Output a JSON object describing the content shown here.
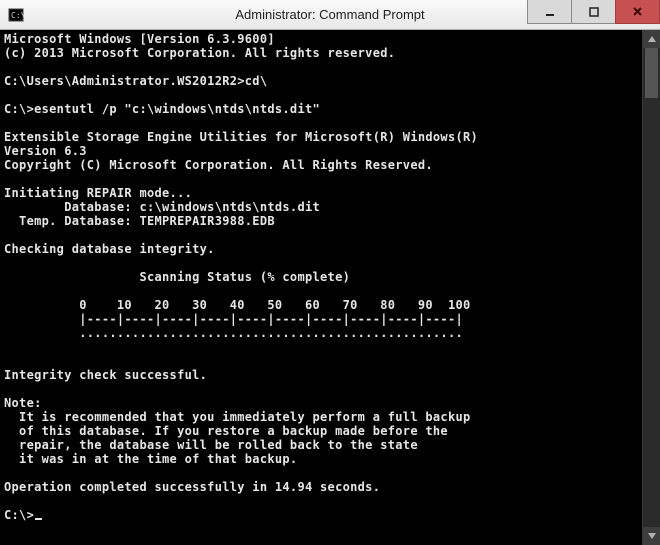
{
  "window": {
    "title": "Administrator: Command Prompt"
  },
  "console": {
    "banner1": "Microsoft Windows [Version 6.3.9600]",
    "banner2": "(c) 2013 Microsoft Corporation. All rights reserved.",
    "prompt1": "C:\\Users\\Administrator.WS2012R2>cd\\",
    "prompt2": "C:\\>esentutl /p \"c:\\windows\\ntds\\ntds.dit\"",
    "util1": "Extensible Storage Engine Utilities for Microsoft(R) Windows(R)",
    "util2": "Version 6.3",
    "util3": "Copyright (C) Microsoft Corporation. All Rights Reserved.",
    "init": "Initiating REPAIR mode...",
    "db": "        Database: c:\\windows\\ntds\\ntds.dit",
    "tdb": "  Temp. Database: TEMPREPAIR3988.EDB",
    "chk": "Checking database integrity.",
    "scan": "                  Scanning Status (% complete)",
    "ticks": "          0    10   20   30   40   50   60   70   80   90  100",
    "bar1": "          |----|----|----|----|----|----|----|----|----|----|",
    "bar2": "          ...................................................",
    "intg": "Integrity check successful.",
    "note": "Note:",
    "n1": "  It is recommended that you immediately perform a full backup",
    "n2": "  of this database. If you restore a backup made before the",
    "n3": "  repair, the database will be rolled back to the state",
    "n4": "  it was in at the time of that backup.",
    "done": "Operation completed successfully in 14.94 seconds.",
    "prompt3": "C:\\>"
  }
}
